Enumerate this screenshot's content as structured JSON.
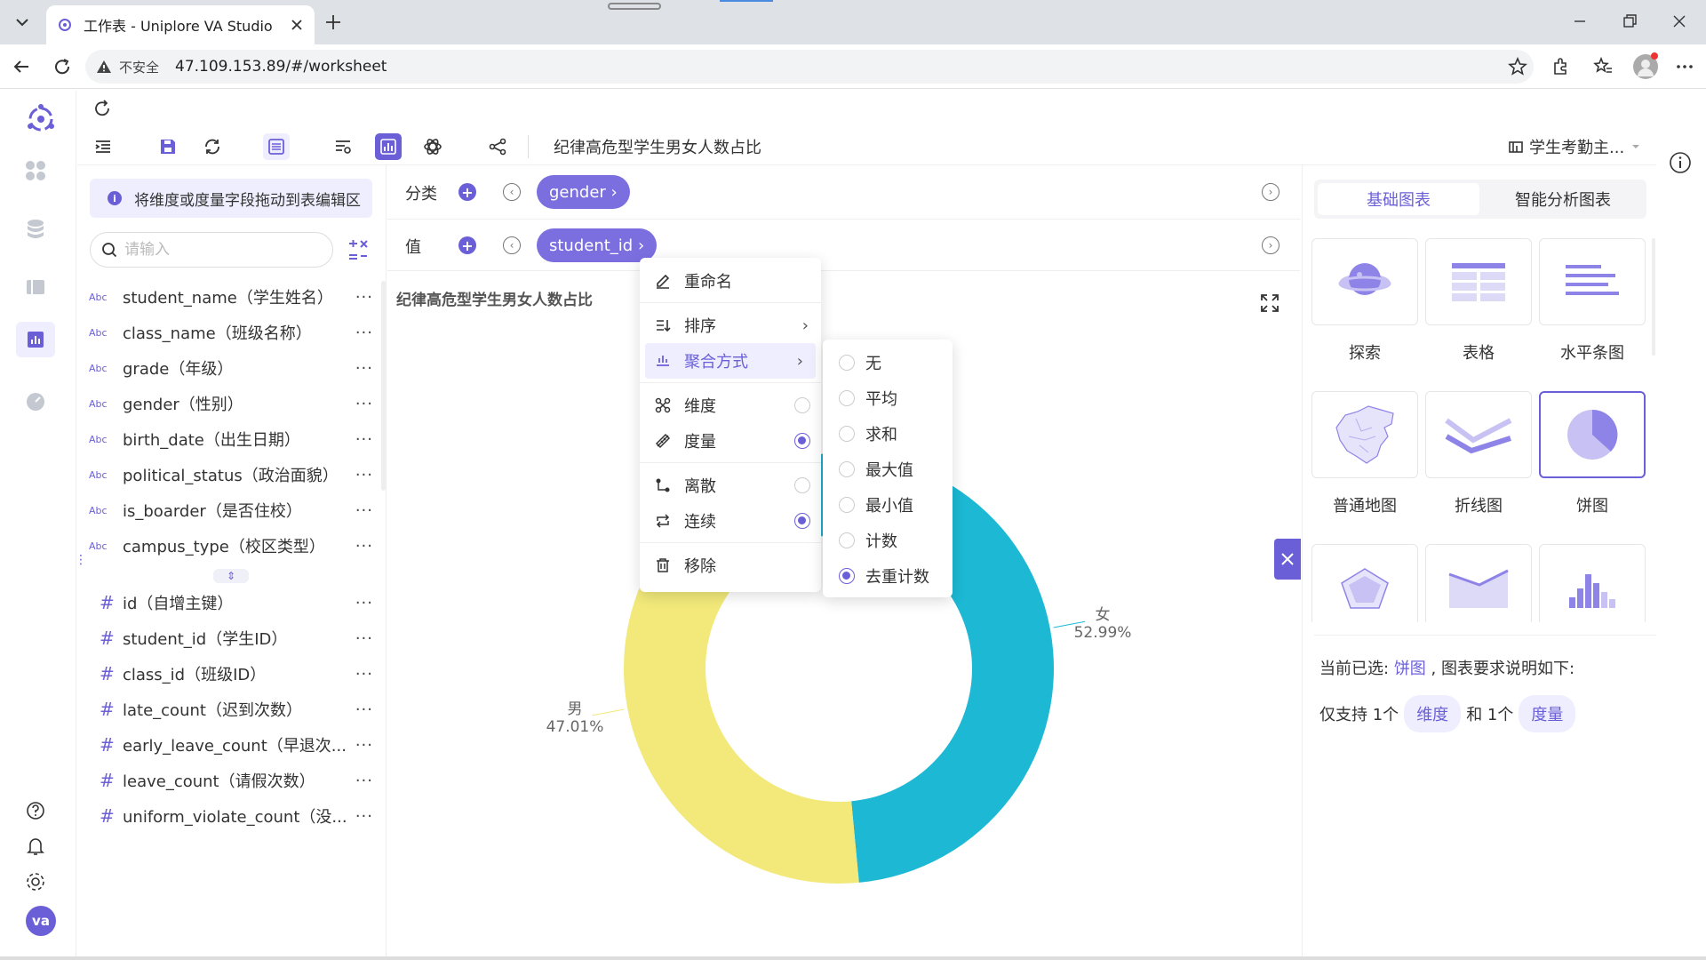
{
  "browser": {
    "tab_title": "工作表 - Uniplore VA Studio",
    "insecure_label": "不安全",
    "url": "47.109.153.89/#/worksheet"
  },
  "worksheet": {
    "title": "纪律高危型学生男女人数占比",
    "datasource": "学生考勤主..."
  },
  "field_panel": {
    "hint": "将维度或度量字段拖动到表编辑区",
    "search_placeholder": "请输入",
    "dimensions": [
      {
        "type": "Abc",
        "name": "student_name（学生姓名）"
      },
      {
        "type": "Abc",
        "name": "class_name（班级名称）"
      },
      {
        "type": "Abc",
        "name": "grade（年级）"
      },
      {
        "type": "Abc",
        "name": "gender（性别）"
      },
      {
        "type": "Abc",
        "name": "birth_date（出生日期）"
      },
      {
        "type": "Abc",
        "name": "political_status（政治面貌）"
      },
      {
        "type": "Abc",
        "name": "is_boarder（是否住校）"
      },
      {
        "type": "Abc",
        "name": "campus_type（校区类型）"
      }
    ],
    "measures": [
      {
        "type": "#",
        "name": "id（自增主键）"
      },
      {
        "type": "#",
        "name": "student_id（学生ID）"
      },
      {
        "type": "#",
        "name": "class_id（班级ID）"
      },
      {
        "type": "#",
        "name": "late_count（迟到次数）"
      },
      {
        "type": "#",
        "name": "early_leave_count（早退次..."
      },
      {
        "type": "#",
        "name": "leave_count（请假次数）"
      },
      {
        "type": "#",
        "name": "uniform_violate_count（没..."
      }
    ],
    "more": "···"
  },
  "shelves": {
    "category_label": "分类",
    "category_pill": "gender ›",
    "value_label": "值",
    "value_pill": "student_id ›"
  },
  "context_menu": {
    "rename": "重命名",
    "sort": "排序",
    "aggregate": "聚合方式",
    "dimension": "维度",
    "measure": "度量",
    "discrete": "离散",
    "continuous": "连续",
    "remove": "移除"
  },
  "aggregate_menu": [
    {
      "label": "无",
      "checked": false
    },
    {
      "label": "平均",
      "checked": false
    },
    {
      "label": "求和",
      "checked": false
    },
    {
      "label": "最大值",
      "checked": false
    },
    {
      "label": "最小值",
      "checked": false
    },
    {
      "label": "计数",
      "checked": false
    },
    {
      "label": "去重计数",
      "checked": true
    }
  ],
  "chart_data": {
    "type": "pie",
    "title": "纪律高危型学生男女人数占比",
    "categories": [
      "男",
      "女"
    ],
    "values": [
      47.01,
      52.99
    ],
    "value_labels": [
      "47.01%",
      "52.99%"
    ],
    "colors": [
      "#f2e97a",
      "#1cb8d4"
    ],
    "donut": true
  },
  "right_panel": {
    "tab_basic": "基础图表",
    "tab_smart": "智能分析图表",
    "chart_types": [
      "探索",
      "表格",
      "水平条图",
      "普通地图",
      "折线图",
      "饼图"
    ],
    "selected_prefix": "当前已选:",
    "selected_chart": "饼图",
    "selected_suffix": ", 图表要求说明如下:",
    "req_prefix": "仅支持 1个",
    "req_dim": "维度",
    "req_mid": "和 1个",
    "req_measure": "度量"
  },
  "colors": {
    "accent": "#6b5fd8"
  }
}
